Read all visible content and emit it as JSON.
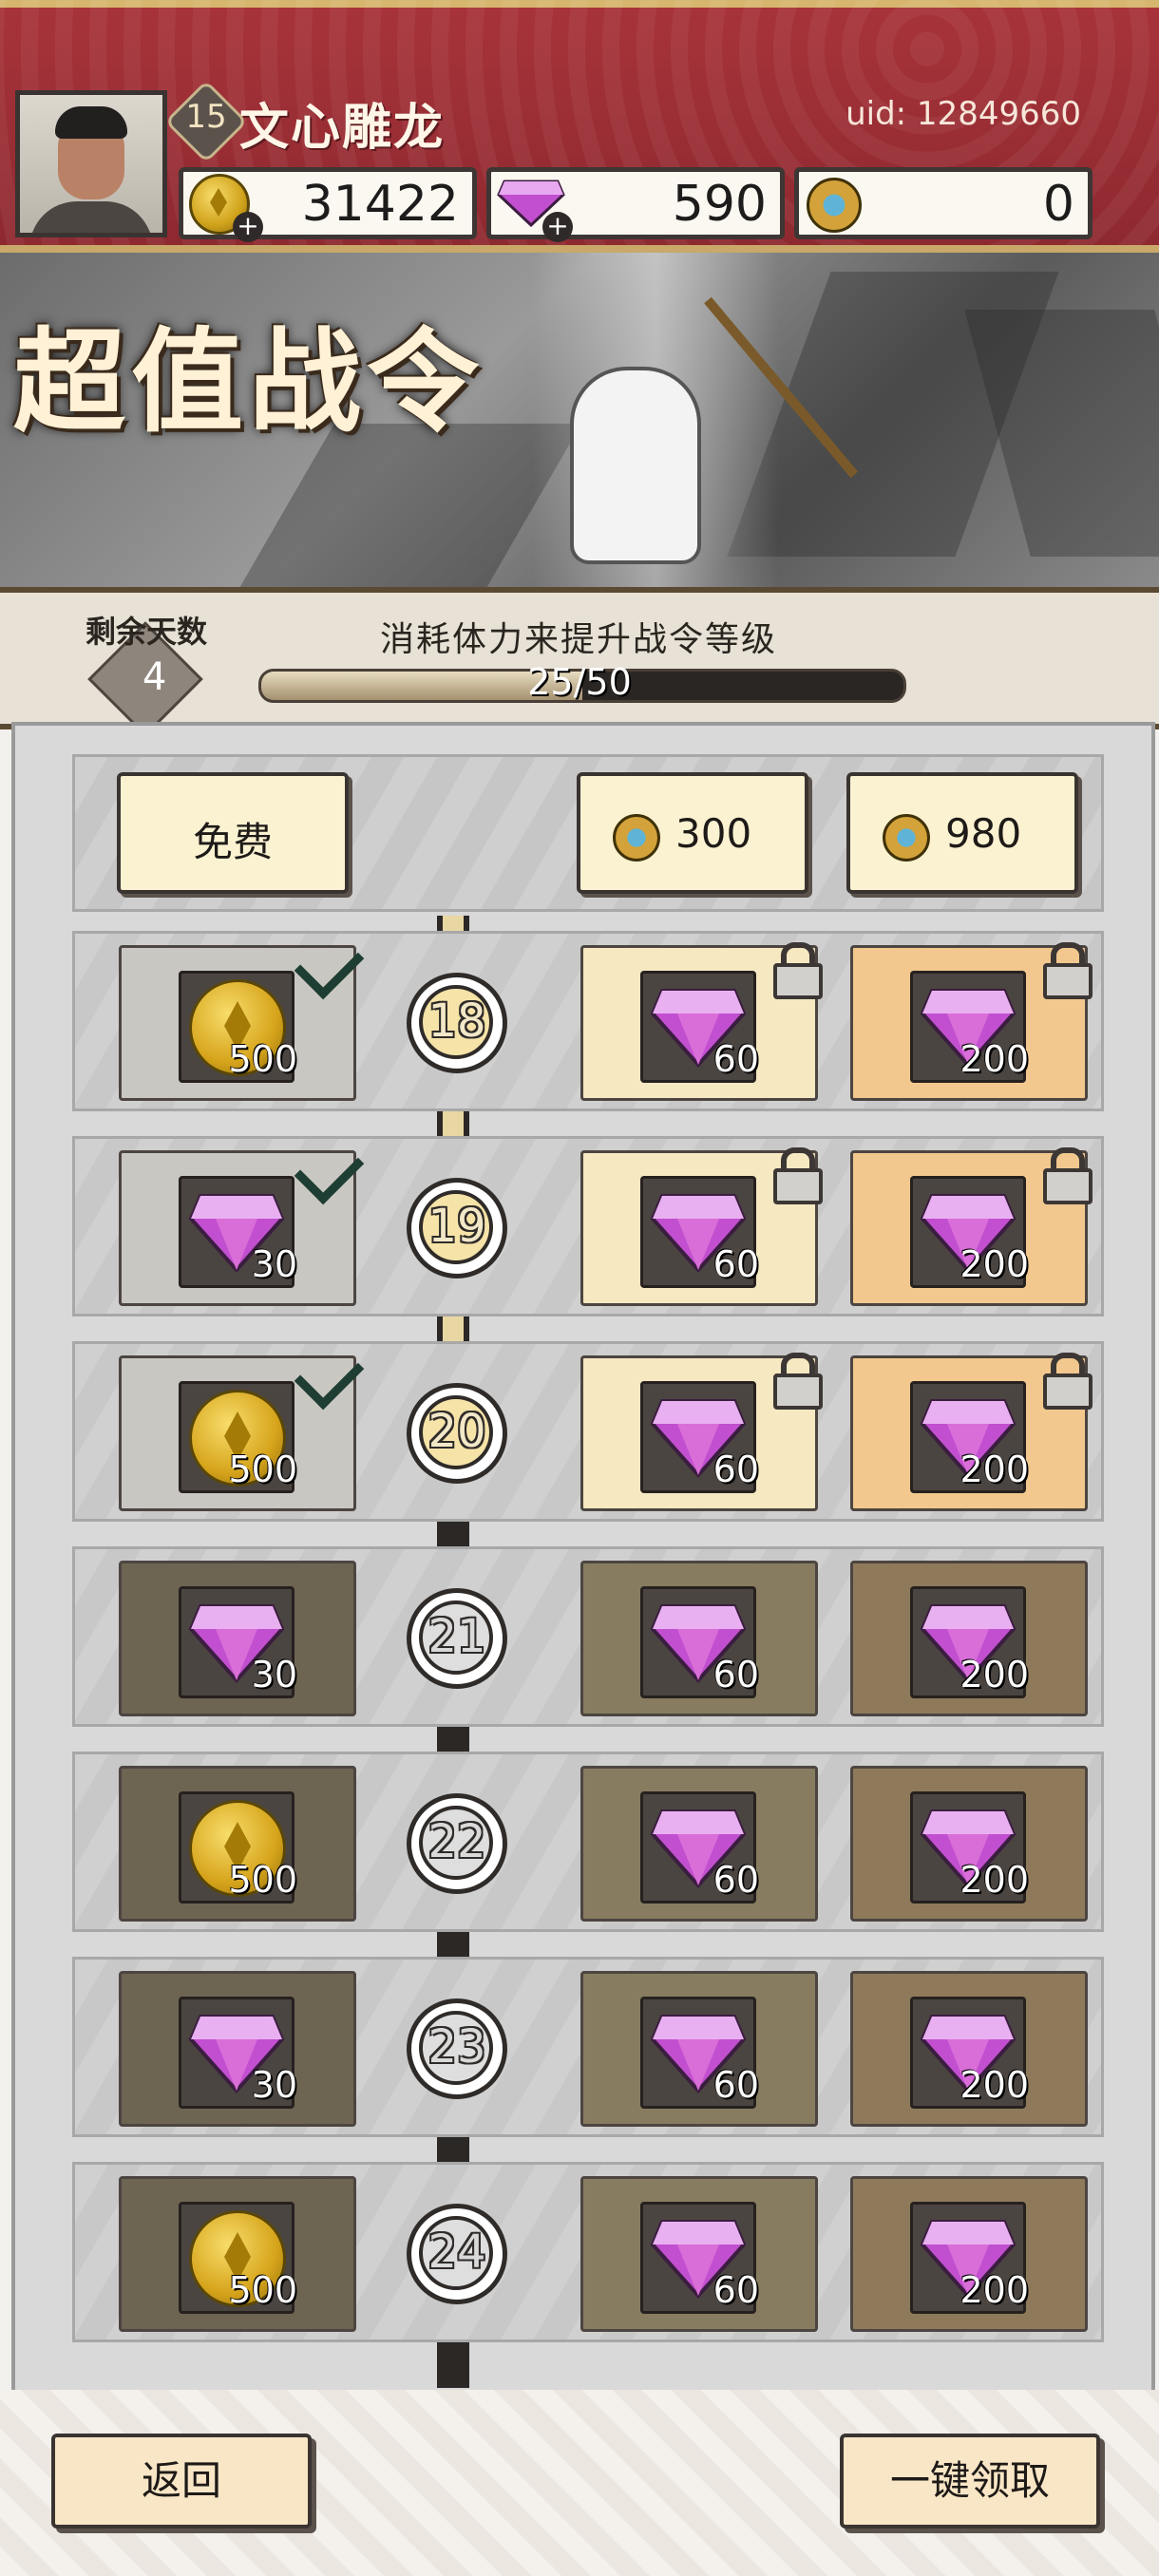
{
  "header": {
    "level": "15",
    "player_name": "文心雕龙",
    "uid": "uid: 12849660",
    "currencies": [
      {
        "name": "gold-coin-icon",
        "value": "31422"
      },
      {
        "name": "gem-icon",
        "value": "590"
      },
      {
        "name": "token-icon",
        "value": "0"
      }
    ]
  },
  "banner": {
    "title": "超值战令"
  },
  "progress": {
    "days_label": "剩余天数",
    "days_value": "4",
    "hint": "消耗体力来提升战令等级",
    "text": "25/50",
    "fraction": 0.5
  },
  "tiers": {
    "free_label": "免费",
    "tier1_price": "300",
    "tier2_price": "980"
  },
  "levels": [
    {
      "level": "18",
      "free": {
        "item": "coin",
        "qty": "500"
      },
      "t1_qty": "60",
      "t2_qty": "200",
      "state": "claimed"
    },
    {
      "level": "19",
      "free": {
        "item": "gem",
        "qty": "30"
      },
      "t1_qty": "60",
      "t2_qty": "200",
      "state": "claimed"
    },
    {
      "level": "20",
      "free": {
        "item": "coin",
        "qty": "500"
      },
      "t1_qty": "60",
      "t2_qty": "200",
      "state": "claimed"
    },
    {
      "level": "21",
      "free": {
        "item": "gem",
        "qty": "30"
      },
      "t1_qty": "60",
      "t2_qty": "200",
      "state": "locked"
    },
    {
      "level": "22",
      "free": {
        "item": "coin",
        "qty": "500"
      },
      "t1_qty": "60",
      "t2_qty": "200",
      "state": "locked"
    },
    {
      "level": "23",
      "free": {
        "item": "gem",
        "qty": "30"
      },
      "t1_qty": "60",
      "t2_qty": "200",
      "state": "locked"
    },
    {
      "level": "24",
      "free": {
        "item": "coin",
        "qty": "500"
      },
      "t1_qty": "60",
      "t2_qty": "200",
      "state": "locked"
    }
  ],
  "buttons": {
    "back": "返回",
    "claim_all": "一键领取"
  }
}
